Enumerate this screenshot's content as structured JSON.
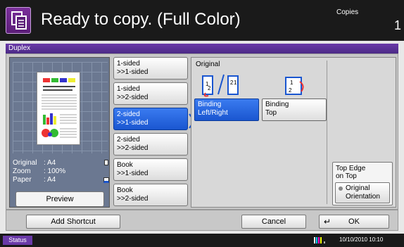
{
  "header": {
    "title": "Ready to copy. (Full Color)",
    "copies_label": "Copies",
    "copies_value": "1"
  },
  "titlebar": {
    "label": "Duplex"
  },
  "preview": {
    "original_key": "Original",
    "original_val": ": A4",
    "zoom_key": "Zoom",
    "zoom_val": ": 100%",
    "paper_key": "Paper",
    "paper_val": ": A4",
    "button": "Preview"
  },
  "duplex_options": [
    {
      "line1": "1-sided",
      "line2": ">>1-sided"
    },
    {
      "line1": "1-sided",
      "line2": ">>2-sided"
    },
    {
      "line1": "2-sided",
      "line2": ">>1-sided"
    },
    {
      "line1": "2-sided",
      "line2": ">>2-sided"
    },
    {
      "line1": "Book",
      "line2": ">>1-sided"
    },
    {
      "line1": "Book",
      "line2": ">>2-sided"
    }
  ],
  "selected_option_index": 2,
  "original": {
    "label": "Original",
    "binding_lr": {
      "line1": "Binding",
      "line2": "Left/Right"
    },
    "binding_top": {
      "line1": "Binding",
      "line2": "Top"
    },
    "top_edge": {
      "line1": "Top Edge",
      "line2": "on Top"
    },
    "orientation": {
      "line1": "Original",
      "line2": "Orientation"
    }
  },
  "bottom": {
    "add_shortcut": "Add Shortcut",
    "cancel": "Cancel",
    "ok": "OK"
  },
  "status": {
    "label": "Status",
    "datetime": "10/10/2010 10:10"
  },
  "colors": {
    "accent": "#1a56d0",
    "brand": "#6a3aa8"
  }
}
